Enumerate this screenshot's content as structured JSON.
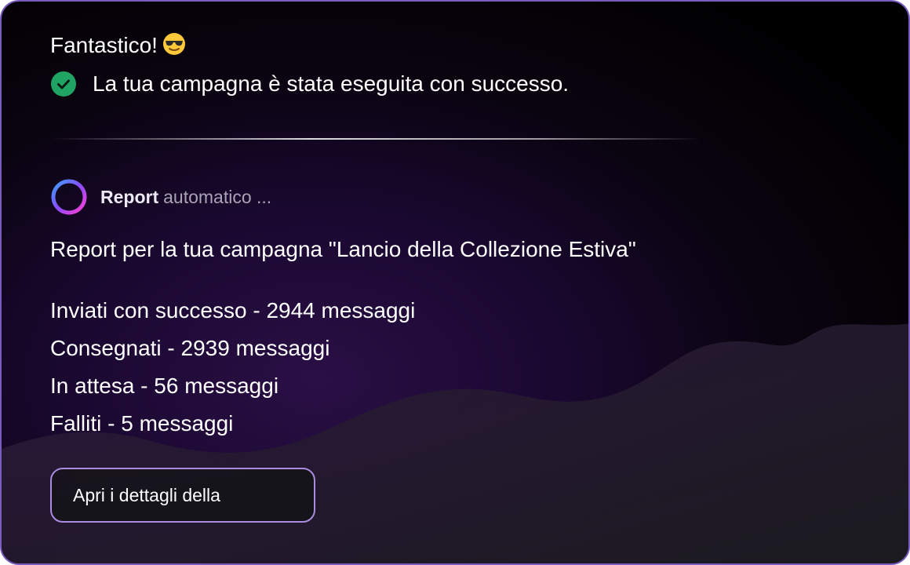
{
  "message": {
    "greeting": "Fantastico!",
    "greeting_icon": "sunglasses-emoji-icon",
    "success_icon": "check-circle-icon",
    "success_text": "La tua campagna è stata eseguita con successo."
  },
  "report": {
    "icon": "loading-ring-icon",
    "label": "Report",
    "status": "automatico ...",
    "title": "Report per la tua campagna \"Lancio della Collezione Estiva\"",
    "stats": [
      "Inviati con successo - 2944 messaggi",
      "Consegnati - 2939 messaggi",
      "In attesa - 56 messaggi",
      "Falliti - 5 messaggi"
    ]
  },
  "actions": {
    "details_label": "Apri i dettagli della"
  },
  "colors": {
    "success_green": "#1fa463",
    "card_border": "#7a5cc0",
    "button_border": "#a98ce0",
    "ring_gradient": [
      "#3aa0ff",
      "#8a4bff",
      "#ff3fd0"
    ]
  }
}
